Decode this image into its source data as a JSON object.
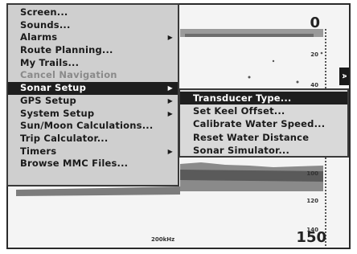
{
  "sonar": {
    "depth_top": "0",
    "depth_bottom": "150",
    "frequency": "200kHz",
    "scale": [
      "20",
      "40",
      "100",
      "120",
      "140"
    ],
    "side_tag": "A"
  },
  "main_menu": {
    "items": [
      {
        "label": "Screen...",
        "submenu": false,
        "disabled": false,
        "selected": false
      },
      {
        "label": "Sounds...",
        "submenu": false,
        "disabled": false,
        "selected": false
      },
      {
        "label": "Alarms",
        "submenu": true,
        "disabled": false,
        "selected": false
      },
      {
        "label": "Route Planning...",
        "submenu": false,
        "disabled": false,
        "selected": false
      },
      {
        "label": "My Trails...",
        "submenu": false,
        "disabled": false,
        "selected": false
      },
      {
        "label": "Cancel Navigation",
        "submenu": false,
        "disabled": true,
        "selected": false
      },
      {
        "label": "Sonar Setup",
        "submenu": true,
        "disabled": false,
        "selected": true
      },
      {
        "label": "GPS Setup",
        "submenu": true,
        "disabled": false,
        "selected": false
      },
      {
        "label": "System Setup",
        "submenu": true,
        "disabled": false,
        "selected": false
      },
      {
        "label": "Sun/Moon Calculations...",
        "submenu": false,
        "disabled": false,
        "selected": false
      },
      {
        "label": "Trip Calculator...",
        "submenu": false,
        "disabled": false,
        "selected": false
      },
      {
        "label": "Timers",
        "submenu": true,
        "disabled": false,
        "selected": false
      },
      {
        "label": "Browse MMC Files...",
        "submenu": false,
        "disabled": false,
        "selected": false
      }
    ],
    "arrow_glyph": "▶"
  },
  "sub_menu": {
    "items": [
      {
        "label": "Transducer Type...",
        "selected": true
      },
      {
        "label": "Set Keel Offset...",
        "selected": false
      },
      {
        "label": "Calibrate Water Speed...",
        "selected": false
      },
      {
        "label": "Reset Water Distance",
        "selected": false
      },
      {
        "label": "Sonar Simulator...",
        "selected": false
      }
    ]
  }
}
